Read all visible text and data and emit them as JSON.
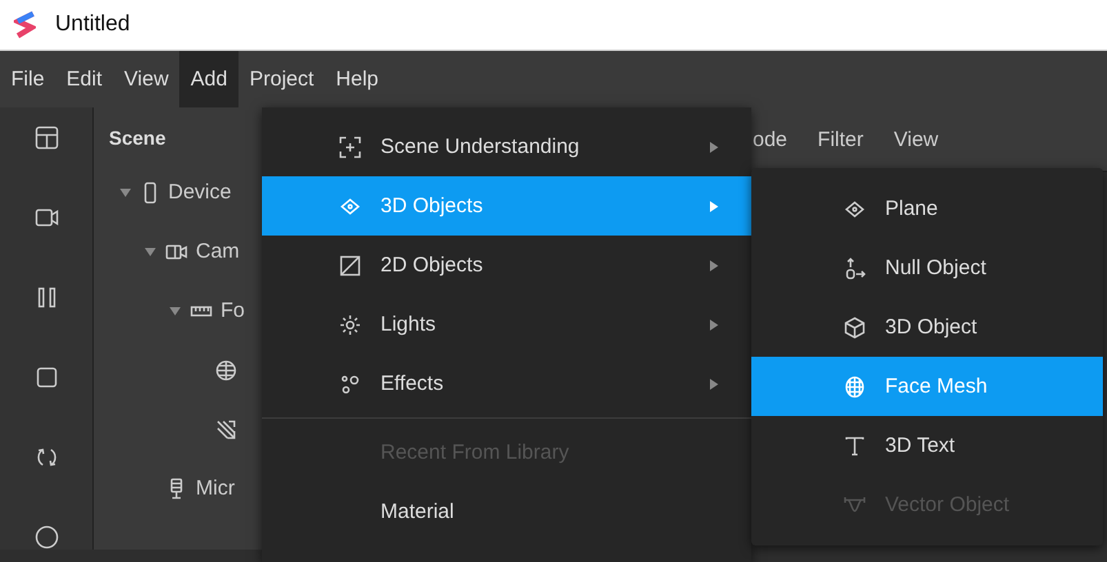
{
  "window": {
    "title": "Untitled"
  },
  "menu_bar": [
    {
      "label": "File",
      "selected": false
    },
    {
      "label": "Edit",
      "selected": false
    },
    {
      "label": "View",
      "selected": false
    },
    {
      "label": "Add",
      "selected": true
    },
    {
      "label": "Project",
      "selected": false
    },
    {
      "label": "Help",
      "selected": false
    }
  ],
  "scene_panel": {
    "title": "Scene",
    "tree": [
      {
        "label": "Device",
        "kind": "device",
        "expanded": true,
        "children": [
          {
            "label": "Cam",
            "kind": "camera",
            "expanded": true,
            "children": [
              {
                "label": "Fo",
                "kind": "ruler",
                "expanded": true,
                "children": [
                  {
                    "kind": "globe"
                  },
                  {
                    "kind": "arrows"
                  }
                ]
              }
            ]
          },
          {
            "label": "Micr",
            "kind": "microphone"
          }
        ]
      }
    ]
  },
  "viewport_toolbar": {
    "items": [
      "ode",
      "Filter",
      "View"
    ]
  },
  "add_menu": {
    "groups": [
      [
        {
          "label": "Scene Understanding",
          "selected": false,
          "disabled": false,
          "submenu": true
        },
        {
          "label": "3D Objects",
          "selected": true,
          "disabled": false,
          "submenu": true
        },
        {
          "label": "2D Objects",
          "selected": false,
          "disabled": false,
          "submenu": true
        },
        {
          "label": "Lights",
          "selected": false,
          "disabled": false,
          "submenu": true
        },
        {
          "label": "Effects",
          "selected": false,
          "disabled": false,
          "submenu": true
        }
      ],
      [
        {
          "label": "Recent From Library",
          "selected": false,
          "disabled": true,
          "submenu": false
        },
        {
          "label": "Material",
          "selected": false,
          "disabled": false,
          "submenu": false
        }
      ]
    ]
  },
  "objects_submenu": {
    "items": [
      {
        "label": "Plane",
        "selected": false,
        "disabled": false
      },
      {
        "label": "Null Object",
        "selected": false,
        "disabled": false
      },
      {
        "label": "3D Object",
        "selected": false,
        "disabled": false
      },
      {
        "label": "Face Mesh",
        "selected": true,
        "disabled": false
      },
      {
        "label": "3D Text",
        "selected": false,
        "disabled": false
      },
      {
        "label": "Vector Object",
        "selected": false,
        "disabled": true
      }
    ]
  }
}
